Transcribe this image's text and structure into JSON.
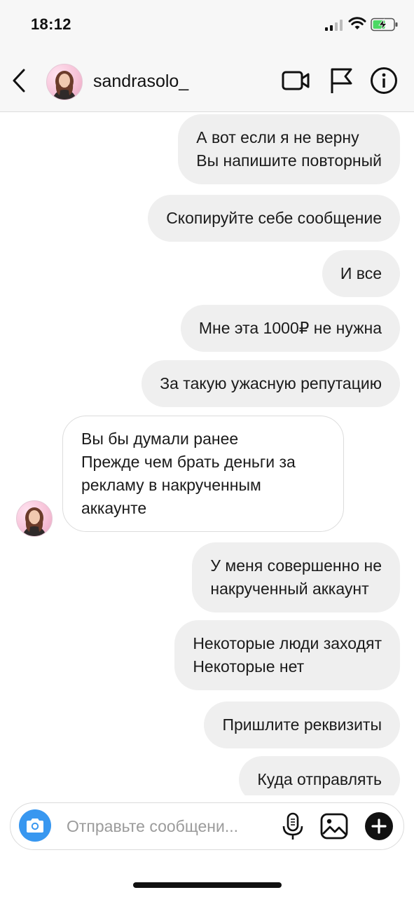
{
  "status_bar": {
    "time": "18:12"
  },
  "header": {
    "username": "sandrasolo_",
    "icons": [
      "back-icon",
      "video-call-icon",
      "flag-icon",
      "info-icon"
    ]
  },
  "messages": [
    {
      "direction": "outgoing",
      "lines": [
        "А вот если я не верну",
        "Вы напишите повторный"
      ]
    },
    {
      "direction": "outgoing",
      "lines": [
        "Скопируйте себе сообщение"
      ]
    },
    {
      "direction": "outgoing",
      "lines": [
        "И все"
      ]
    },
    {
      "direction": "outgoing",
      "lines": [
        "Мне эта 1000₽ не нужна"
      ]
    },
    {
      "direction": "outgoing",
      "lines": [
        "За такую ужасную репутацию"
      ]
    },
    {
      "direction": "incoming",
      "lines": [
        "Вы бы думали ранее",
        "Прежде чем брать деньги за",
        "рекламу в накрученным",
        "аккаунте"
      ]
    },
    {
      "direction": "outgoing",
      "lines": [
        "У меня совершенно не",
        "накрученный аккаунт"
      ]
    },
    {
      "direction": "outgoing",
      "lines": [
        "Некоторые люди заходят",
        "Некоторые нет"
      ]
    },
    {
      "direction": "outgoing",
      "lines": [
        "Пришлите реквизиты"
      ]
    },
    {
      "direction": "outgoing",
      "lines": [
        "Куда отправлять"
      ]
    }
  ],
  "composer": {
    "placeholder": "Отправьте сообщени...",
    "icons": [
      "camera-icon",
      "microphone-icon",
      "gallery-icon",
      "plus-icon"
    ]
  },
  "colors": {
    "outgoing_bubble": "#efefef",
    "incoming_border": "#dcdcdc",
    "camera_button": "#3897f0",
    "battery_charging": "#4cd964"
  }
}
